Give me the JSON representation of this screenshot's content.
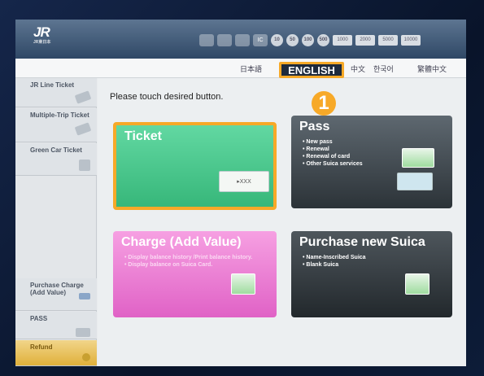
{
  "header": {
    "logo": "JR",
    "logo_sub": "JR東日本"
  },
  "coins": {
    "slots": [
      "",
      "",
      "",
      "IC"
    ],
    "coin_values": [
      "10",
      "50",
      "100",
      "500"
    ],
    "note_values": [
      "1000",
      "2000",
      "5000",
      "10000"
    ]
  },
  "languages": {
    "items": [
      "日本語",
      "ENGLISH",
      "中文",
      "한국어",
      "繁體中文"
    ],
    "selected": "ENGLISH"
  },
  "sidebar": {
    "items": [
      {
        "label": "JR Line Ticket"
      },
      {
        "label": "Multiple-Trip Ticket"
      },
      {
        "label": "Green Car Ticket"
      },
      {
        "label": "Purchase Charge (Add Value)"
      },
      {
        "label": "PASS"
      },
      {
        "label": "Refund"
      }
    ]
  },
  "main": {
    "prompt": "Please touch desired button.",
    "ticket": {
      "title": "Ticket",
      "mini": "▸XXX"
    },
    "pass": {
      "title": "Pass",
      "items": [
        "New pass",
        "Renewal",
        "Renewal of card",
        "Other Suica services"
      ]
    },
    "charge": {
      "title": "Charge (Add Value)",
      "items": [
        "Display balance history /Print balance history.",
        "Display balance on Suica Card."
      ]
    },
    "suica": {
      "title": "Purchase new Suica",
      "items": [
        "Name-Inscribed Suica",
        "Blank Suica"
      ]
    }
  },
  "annotation": {
    "step": "1"
  },
  "colors": {
    "highlight": "#f7a928",
    "ticket": "#3cc084",
    "charge": "#e56ccb",
    "dark": "#2c3338"
  }
}
